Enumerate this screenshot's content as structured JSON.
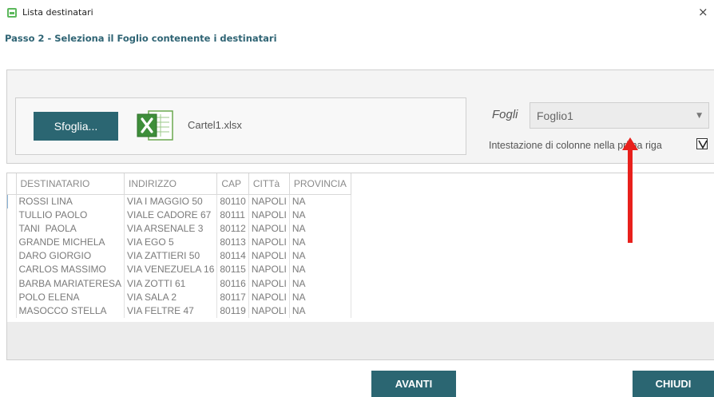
{
  "window": {
    "title": "Lista destinatari",
    "close_glyph": "×"
  },
  "step_title": "Passo 2 - Seleziona il Foglio contenente i destinatari",
  "file": {
    "browse_label": "Sfoglia...",
    "icon": "excel-icon",
    "file_name": "Cartel1.xlsx"
  },
  "sheet": {
    "label": "Fogli",
    "selected": "Foglio1",
    "header_row_label": "Intestazione di colonne nella prima riga",
    "header_row_checked": true
  },
  "grid": {
    "columns": [
      "DESTINATARIO",
      "INDIRIZZO",
      "CAP",
      "CITTà",
      "PROVINCIA"
    ],
    "rows": [
      [
        "ROSSI LINA",
        "VIA I MAGGIO 50",
        "80110",
        "NAPOLI",
        "NA"
      ],
      [
        "TULLIO PAOLO",
        "VIALE CADORE 67",
        "80111",
        "NAPOLI",
        "NA"
      ],
      [
        "TANI  PAOLA",
        "VIA ARSENALE 3",
        "80112",
        "NAPOLI",
        "NA"
      ],
      [
        "GRANDE MICHELA",
        "VIA EGO 5",
        "80113",
        "NAPOLI",
        "NA"
      ],
      [
        "DARO GIORGIO",
        "VIA ZATTIERI 50",
        "80114",
        "NAPOLI",
        "NA"
      ],
      [
        "CARLOS MASSIMO",
        "VIA VENEZUELA 16",
        "80115",
        "NAPOLI",
        "NA"
      ],
      [
        "BARBA MARIATERESA",
        "VIA ZOTTI 61",
        "80116",
        "NAPOLI",
        "NA"
      ],
      [
        "POLO ELENA",
        "VIA SALA 2",
        "80117",
        "NAPOLI",
        "NA"
      ],
      [
        "MASOCCO STELLA",
        "VIA FELTRE 47",
        "80119",
        "NAPOLI",
        "NA"
      ]
    ]
  },
  "buttons": {
    "next": "AVANTI",
    "close": "CHIUDI"
  },
  "colors": {
    "accent": "#2b6672",
    "title": "#2f6474",
    "annotation_arrow": "#e8201c"
  }
}
